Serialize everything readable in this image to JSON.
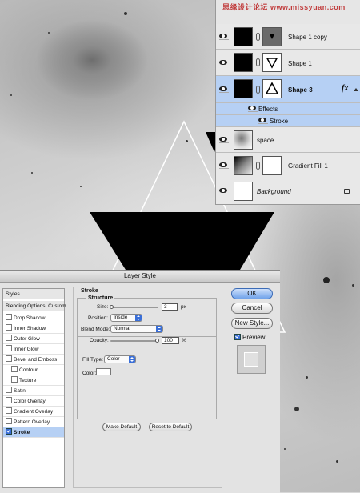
{
  "layers_panel": {
    "layers": [
      {
        "name": "Shape 1 copy",
        "visible": true,
        "thumbnail": "black",
        "mask": "triangle-down-small"
      },
      {
        "name": "Shape 1",
        "visible": true,
        "thumbnail": "black",
        "mask": "triangle-down"
      },
      {
        "name": "Shape 3",
        "visible": true,
        "selected": true,
        "thumbnail": "black",
        "mask": "triangle-up",
        "fx": "fx"
      },
      {
        "name": "space",
        "visible": true,
        "thumbnail": "space-photo"
      },
      {
        "name": "Gradient Fill 1",
        "visible": true,
        "thumbnail": "gradient",
        "mask": "white"
      },
      {
        "name": "Background",
        "visible": true,
        "thumbnail": "white",
        "locked": true
      }
    ],
    "effects_label": "Effects",
    "stroke_effect_label": "Stroke"
  },
  "dialog": {
    "title": "Layer Style",
    "styles_header": "Styles",
    "blending_label": "Blending Options: Custom",
    "styles": [
      {
        "label": "Drop Shadow",
        "checked": false
      },
      {
        "label": "Inner Shadow",
        "checked": false
      },
      {
        "label": "Outer Glow",
        "checked": false
      },
      {
        "label": "Inner Glow",
        "checked": false
      },
      {
        "label": "Bevel and Emboss",
        "checked": false
      },
      {
        "label": "Contour",
        "checked": false,
        "indent": true
      },
      {
        "label": "Texture",
        "checked": false,
        "indent": true
      },
      {
        "label": "Satin",
        "checked": false
      },
      {
        "label": "Color Overlay",
        "checked": false
      },
      {
        "label": "Gradient Overlay",
        "checked": false
      },
      {
        "label": "Pattern Overlay",
        "checked": false
      },
      {
        "label": "Stroke",
        "checked": true,
        "selected": true
      }
    ],
    "stroke": {
      "section_title": "Stroke",
      "structure_title": "Structure",
      "size_label": "Size:",
      "size_value": "3",
      "size_unit": "px",
      "size_slider_fraction": 0.02,
      "position_label": "Position:",
      "position_value": "Inside",
      "blend_label": "Blend Mode:",
      "blend_value": "Normal",
      "opacity_label": "Opacity:",
      "opacity_value": "100",
      "opacity_unit": "%",
      "opacity_slider_fraction": 1.0,
      "filltype_label": "Fill Type:",
      "filltype_value": "Color",
      "color_label": "Color:",
      "color_value": "#ffffff",
      "make_default": "Make Default",
      "reset_default": "Reset to Default"
    },
    "buttons": {
      "ok": "OK",
      "cancel": "Cancel",
      "new_style": "New Style...",
      "preview_label": "Preview",
      "preview_checked": true
    }
  },
  "colors": {
    "selection": "#b6d0f4",
    "accent": "#3a6fd8"
  }
}
